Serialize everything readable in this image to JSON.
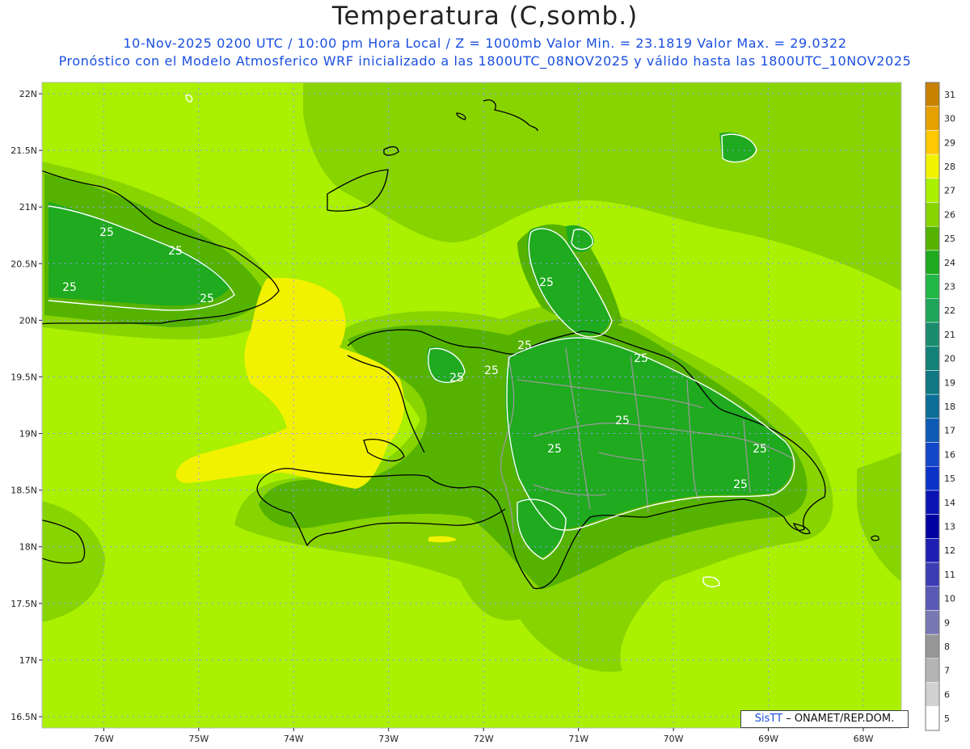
{
  "header": {
    "title": "Temperatura (C,somb.)",
    "line1": "10-Nov-2025 0200 UTC / 10:00 pm Hora Local / Z = 1000mb   Valor Min. = 23.1819  Valor Max. = 29.0322",
    "line2": "Pronóstico con el Modelo Atmosferico WRF inicializado a las 1800UTC_08NOV2025 y válido hasta las  1800UTC_10NOV2025"
  },
  "map": {
    "lat_labels": [
      "22N",
      "21.5N",
      "21N",
      "20.5N",
      "20N",
      "19.5N",
      "19N",
      "18.5N",
      "18N",
      "17.5N",
      "17N",
      "16.5N"
    ],
    "lon_labels": [
      "76W",
      "75W",
      "74W",
      "73W",
      "72W",
      "71W",
      "70W",
      "69W",
      "68W"
    ],
    "contour_labels": [
      "25",
      "25",
      "25",
      "25",
      "25",
      "25",
      "25",
      "25",
      "25",
      "25",
      "25",
      "25",
      "25"
    ],
    "colors": {
      "background_field": "#aaf000",
      "level_26": "#88d400",
      "level_25": "#55b300",
      "level_24": "#1faa1f",
      "level_29": "#f2f200",
      "coastline": "#000000",
      "border": "#999999",
      "grid": "#9999ff"
    }
  },
  "colorbar": {
    "levels": [
      "31",
      "30",
      "29",
      "28",
      "27",
      "26",
      "25",
      "24",
      "23",
      "22",
      "21",
      "20",
      "19",
      "18",
      "17",
      "16",
      "15",
      "14",
      "13",
      "12",
      "11",
      "10",
      "9",
      "8",
      "7",
      "6",
      "5"
    ],
    "colors": [
      "#c88200",
      "#e6a000",
      "#ffc800",
      "#f2f200",
      "#aaf000",
      "#88d400",
      "#55b300",
      "#1faa1f",
      "#22b846",
      "#1ea55a",
      "#198c6e",
      "#148278",
      "#0f7882",
      "#0a6e96",
      "#0f5ab4",
      "#1446c8",
      "#0a32c8",
      "#0a14b4",
      "#0000a0",
      "#1e1eb4",
      "#3c3cb4",
      "#5a5ab4",
      "#7878b4",
      "#969696",
      "#b4b4b4",
      "#d2d2d2",
      "#ffffff"
    ]
  },
  "credit": {
    "brand": "SisTT",
    "text": " – ONAMET/REP.DOM."
  }
}
